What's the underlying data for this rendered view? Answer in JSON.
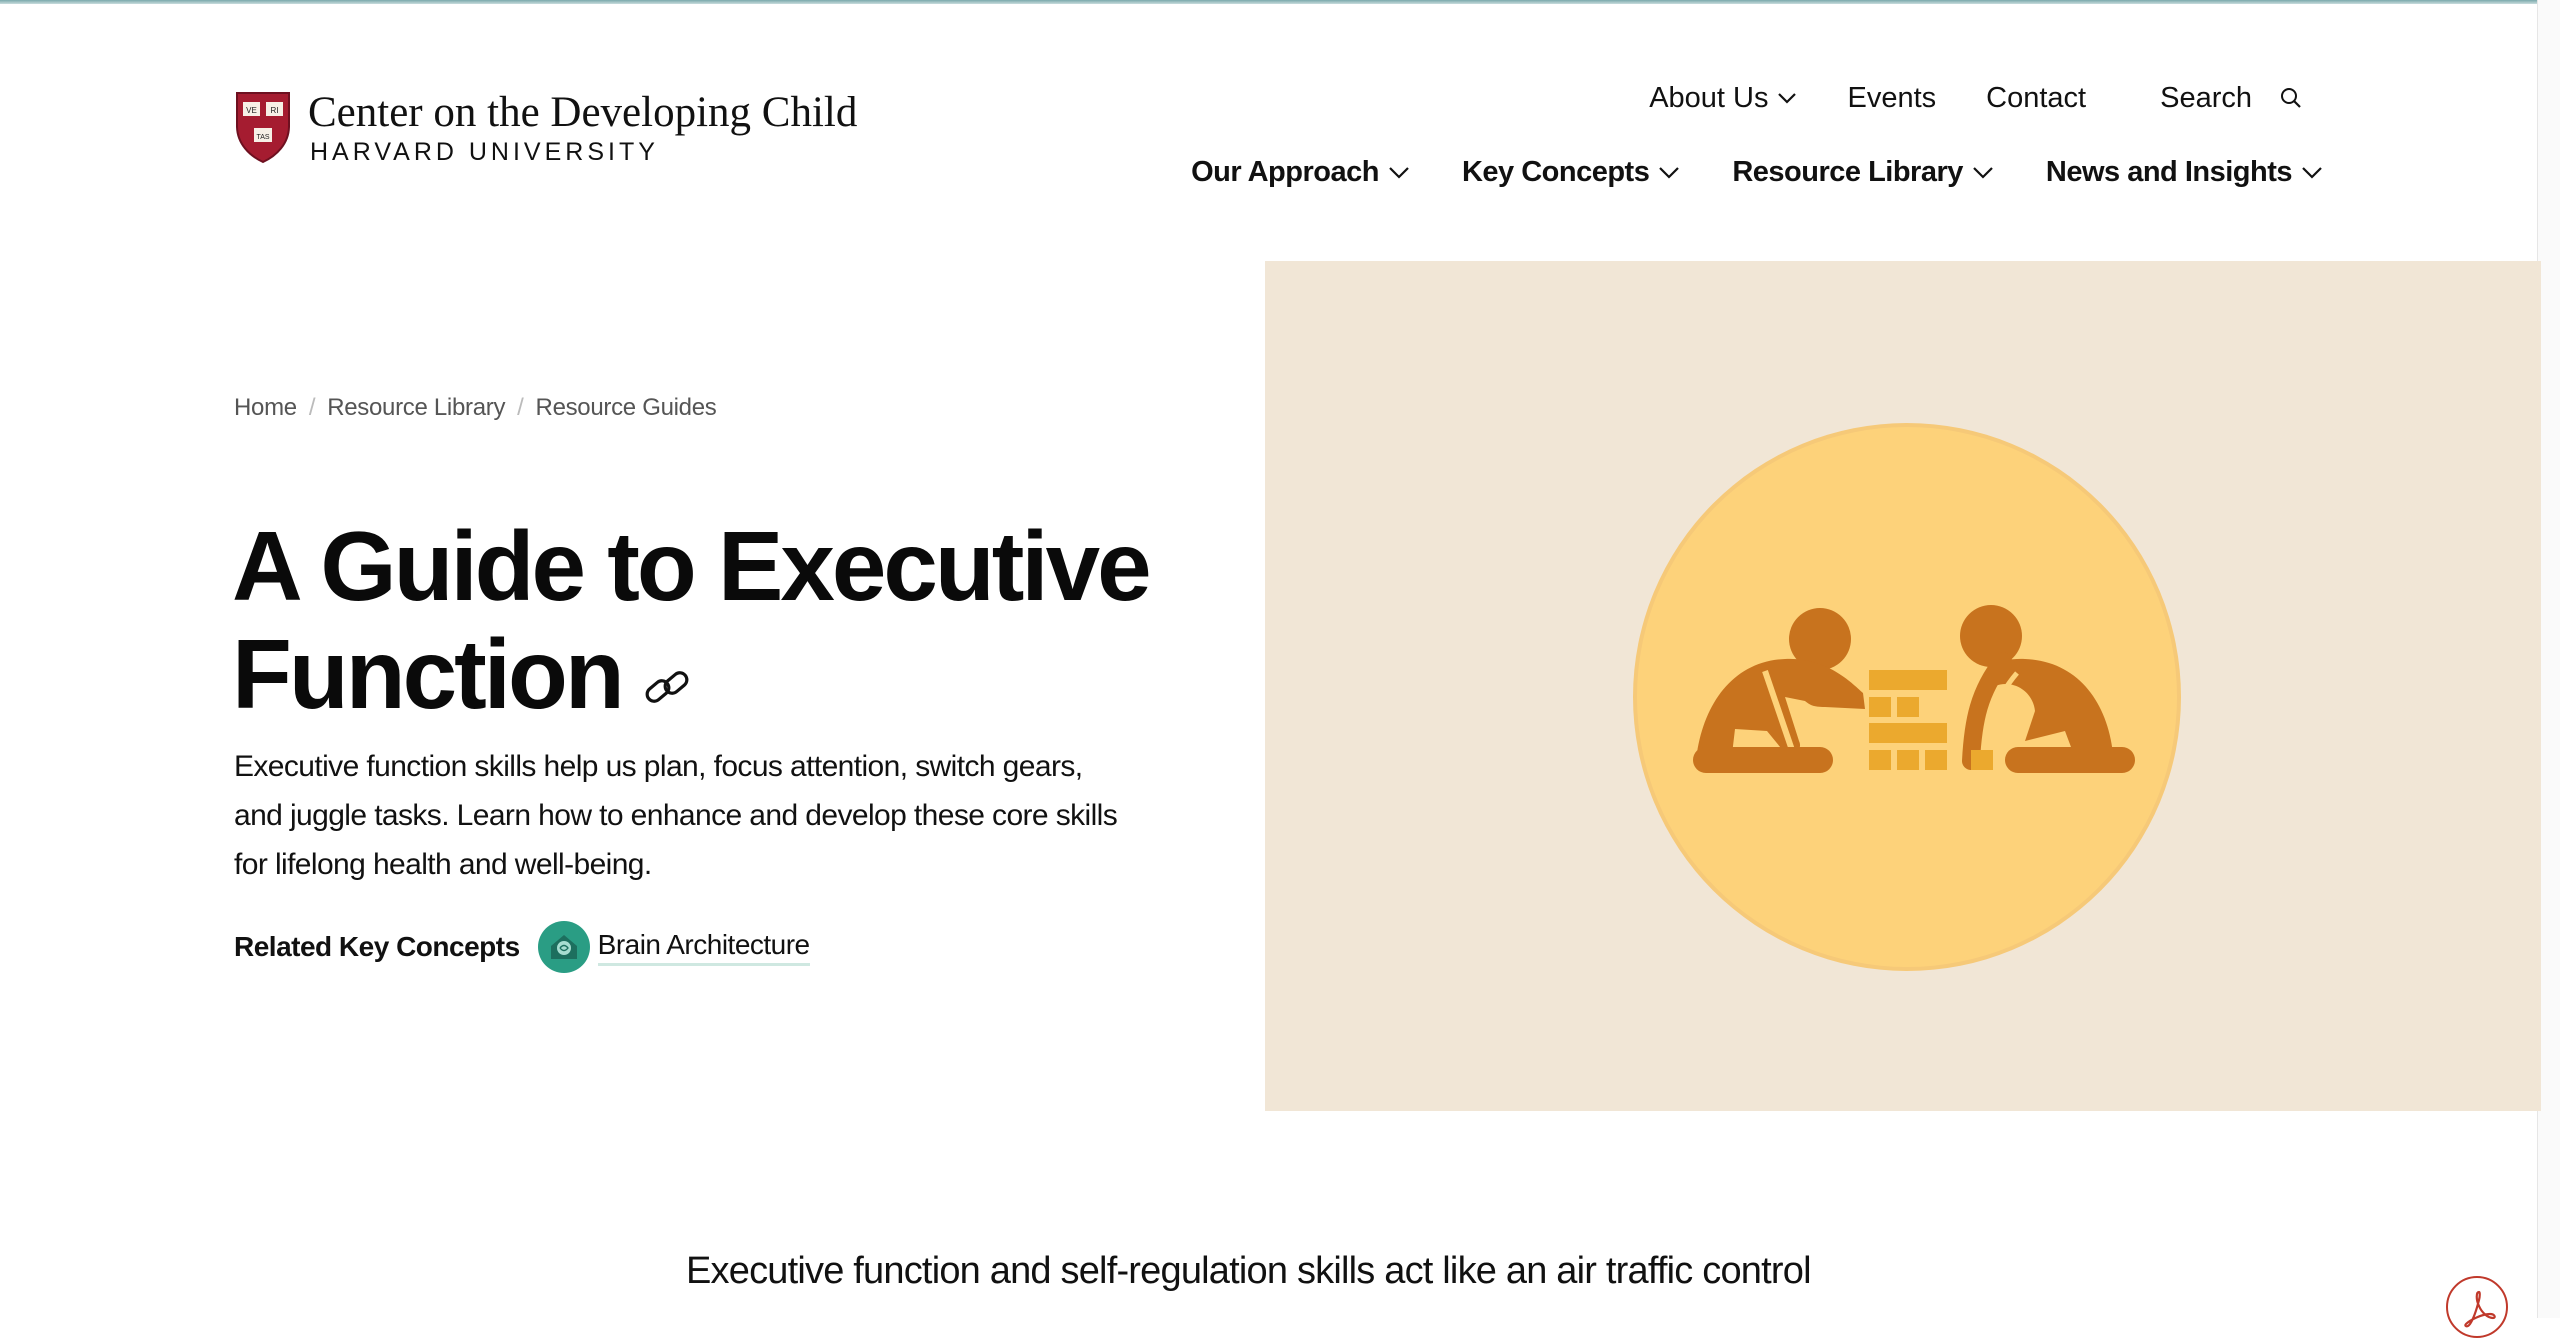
{
  "org": {
    "name": "Center on the Developing Child",
    "university": "HARVARD UNIVERSITY",
    "shield_text": [
      "VE",
      "RI",
      "TAS"
    ]
  },
  "utility_nav": {
    "about": "About Us",
    "events": "Events",
    "contact": "Contact",
    "search": "Search"
  },
  "main_nav": [
    {
      "label": "Our Approach"
    },
    {
      "label": "Key Concepts"
    },
    {
      "label": "Resource Library"
    },
    {
      "label": "News and Insights"
    }
  ],
  "breadcrumb": [
    "Home",
    "Resource Library",
    "Resource Guides"
  ],
  "page": {
    "title_line1": "A Guide to Executive",
    "title_line2": "Function",
    "intro": "Executive function skills help us plan, focus attention, switch gears, and juggle tasks. Learn how to enhance and develop these core skills for lifelong health and well-being.",
    "related_label": "Related Key Concepts",
    "related_concept": "Brain Architecture"
  },
  "body": {
    "lead": "Executive function and self-regulation skills act like an air traffic control"
  },
  "colors": {
    "accent_teal": "#2a9d84",
    "hero_bg": "#f1e6d6",
    "hero_circle": "#fcd077",
    "figure": "#c8731e",
    "blocks": "#eba92e",
    "shield_red": "#a51c30"
  }
}
